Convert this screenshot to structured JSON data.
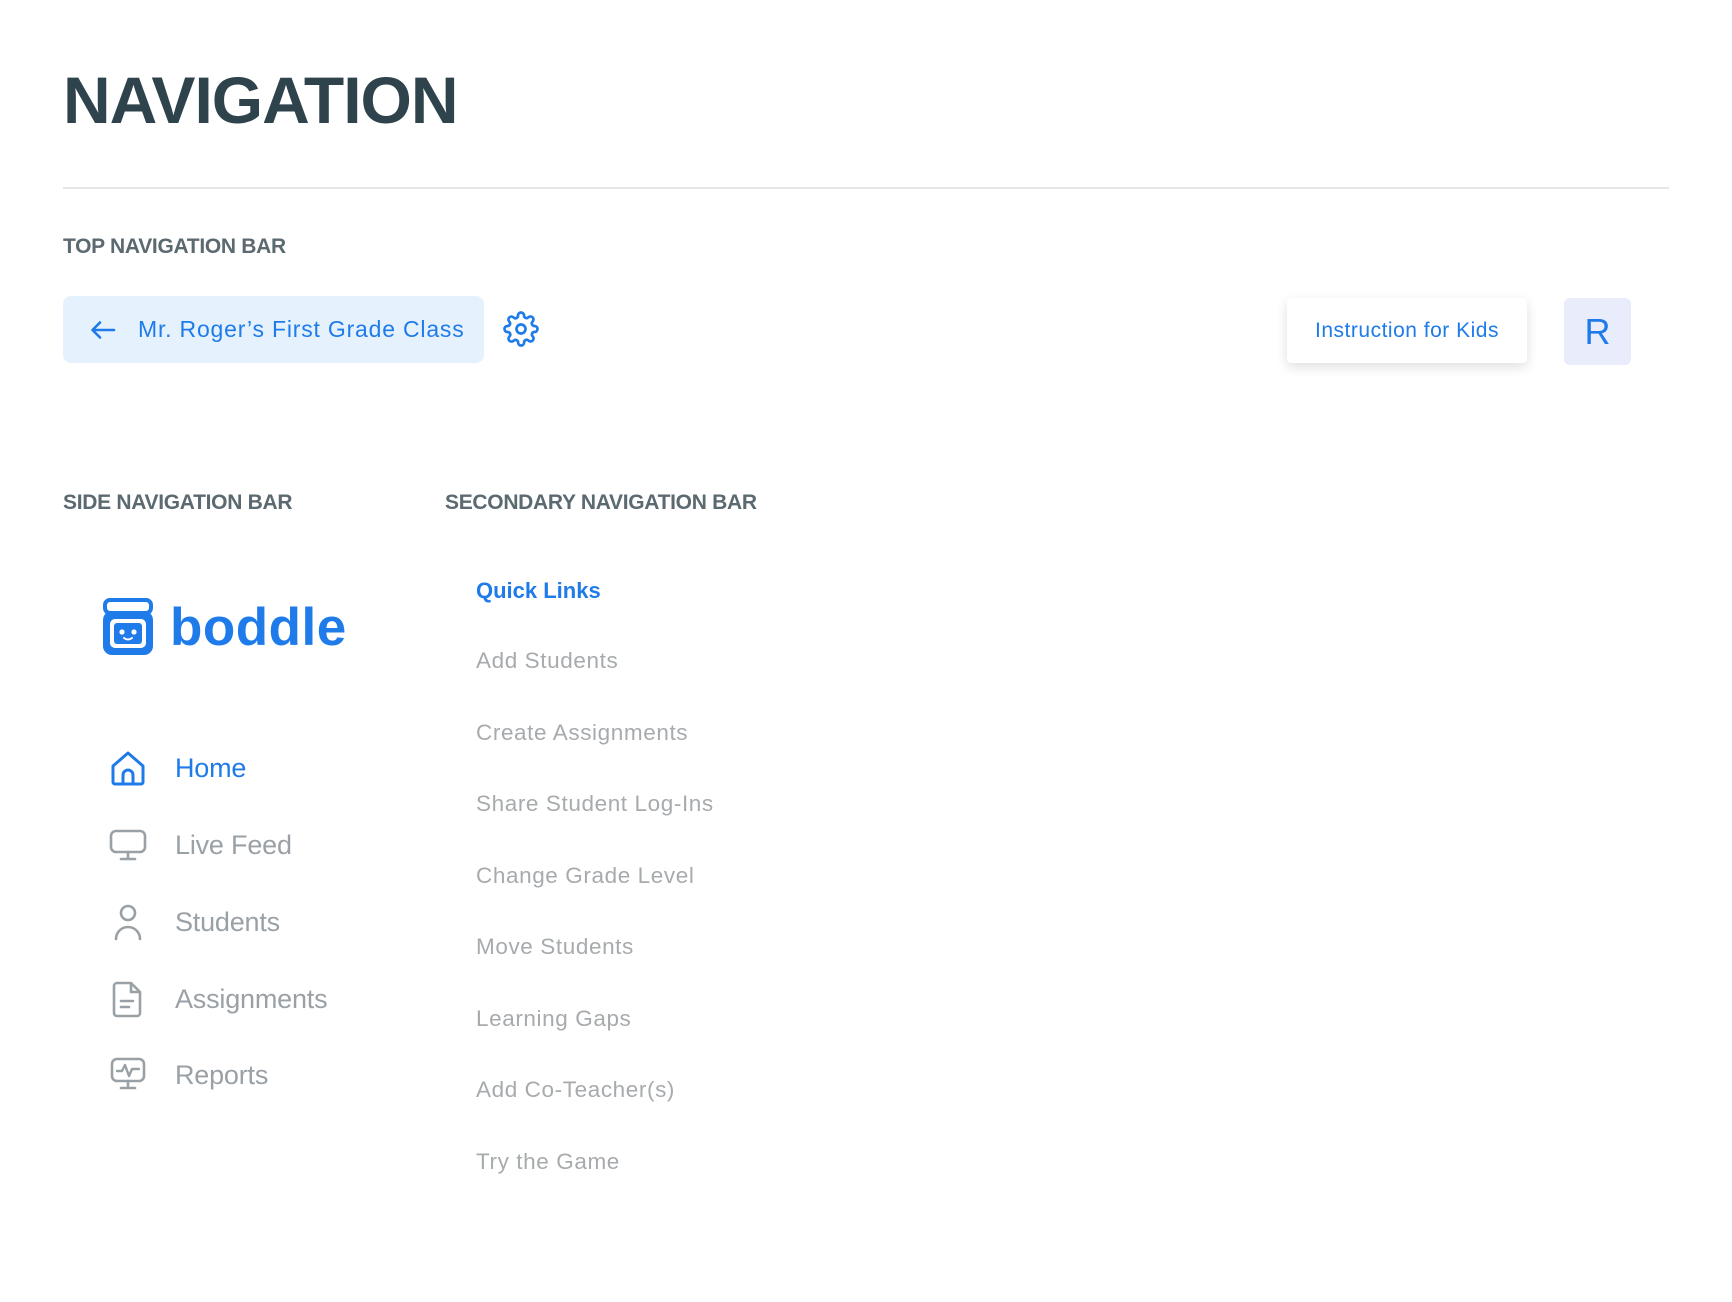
{
  "page": {
    "title": "NAVIGATION"
  },
  "sections": {
    "top_nav_label": "TOP NAVIGATION BAR",
    "side_nav_label": "SIDE NAVIGATION BAR",
    "secondary_nav_label": "SECONDARY NAVIGATION BAR"
  },
  "top_nav": {
    "back_icon": "arrow-left-icon",
    "class_name": "Mr. Roger’s First Grade Class",
    "settings_icon": "gear-icon",
    "kids_button_label": "Instruction for Kids",
    "avatar_initial": "R"
  },
  "logo": {
    "text": "boddle"
  },
  "side_nav": {
    "items": [
      {
        "label": "Home",
        "icon": "home-icon",
        "active": true
      },
      {
        "label": "Live Feed",
        "icon": "monitor-icon",
        "active": false
      },
      {
        "label": "Students",
        "icon": "user-icon",
        "active": false
      },
      {
        "label": "Assignments",
        "icon": "document-icon",
        "active": false
      },
      {
        "label": "Reports",
        "icon": "pulse-monitor-icon",
        "active": false
      }
    ]
  },
  "secondary_nav": {
    "heading": "Quick Links",
    "links": [
      "Add Students",
      "Create Assignments",
      "Share Student Log-Ins",
      "Change Grade Level",
      "Move Students",
      "Learning Gaps",
      "Add Co-Teacher(s)",
      "Try the Game"
    ]
  },
  "colors": {
    "accent": "#1f7bea",
    "pill_background": "#e5f2fd",
    "avatar_background": "#e9edfb",
    "heading_text": "#2f434c",
    "muted_text": "#9aa1a6"
  }
}
